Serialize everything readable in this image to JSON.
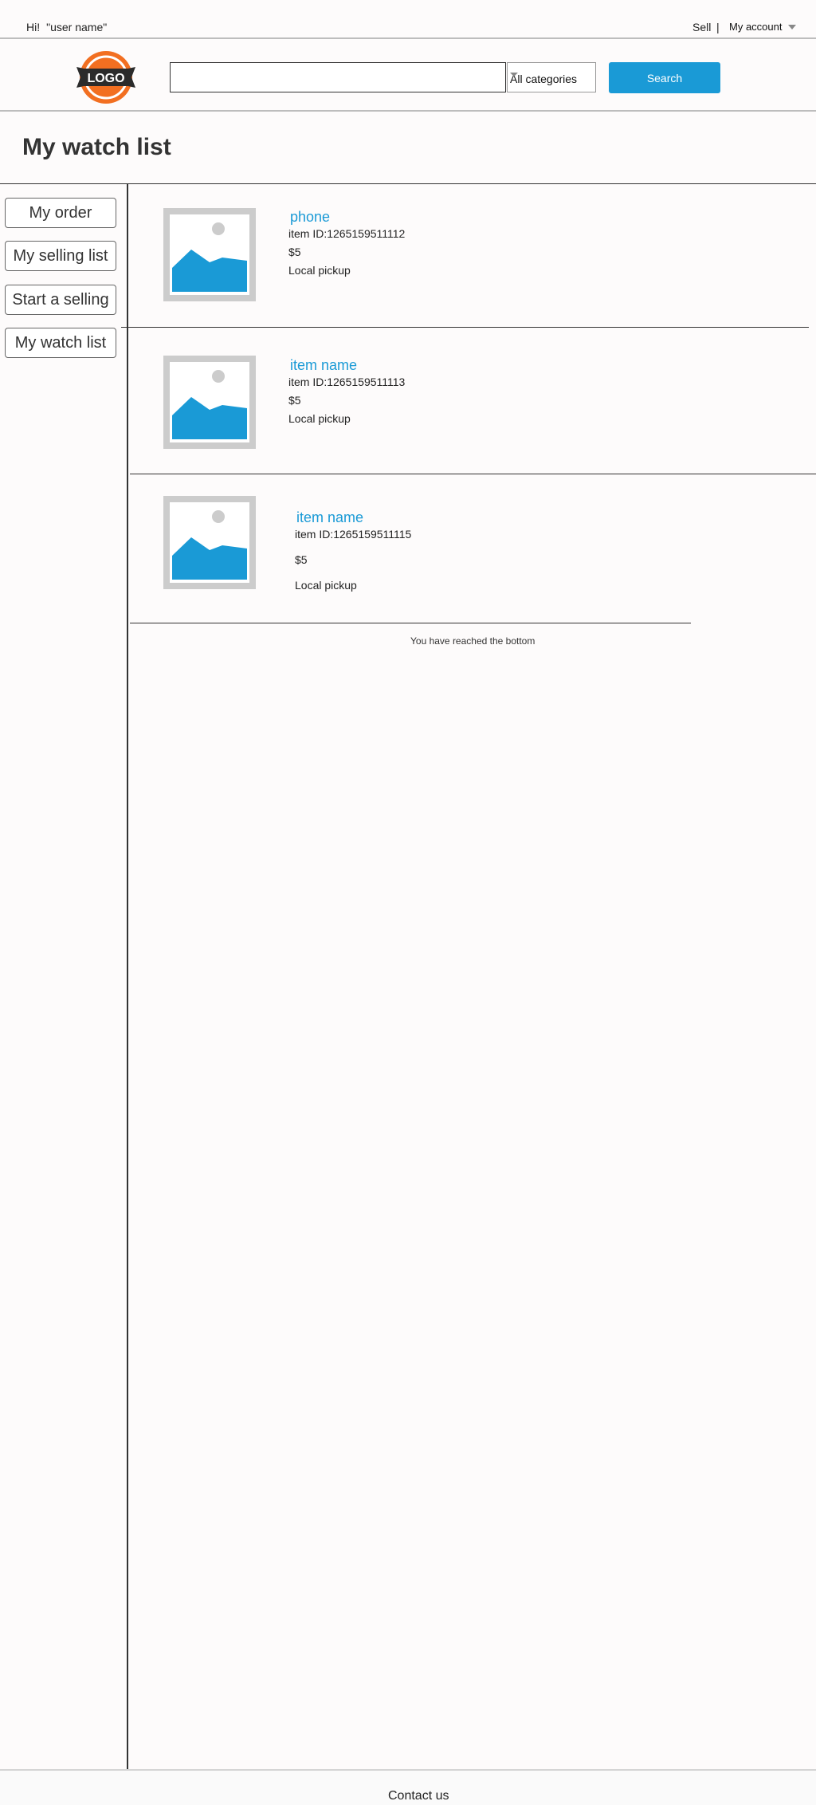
{
  "header": {
    "greeting": "Hi!",
    "user_name": "\"user name\"",
    "sell_label": "Sell",
    "separator": "|",
    "account_label": "My account"
  },
  "logo": {
    "text": "LOGO",
    "colors": {
      "ring": "#f26f21",
      "banner": "#2b2b2b"
    }
  },
  "search": {
    "input_value": "",
    "category": "All categories",
    "button_label": "Search",
    "button_color": "#1a9ad6"
  },
  "page": {
    "title": "My watch list"
  },
  "sidebar": {
    "items": [
      {
        "label": "My order"
      },
      {
        "label": "My selling list"
      },
      {
        "label": "Start a selling"
      },
      {
        "label": "My watch list"
      }
    ]
  },
  "watchlist": {
    "items": [
      {
        "name": "phone",
        "item_id": "item ID:1265159511112",
        "price": "$5",
        "shipping": "Local pickup"
      },
      {
        "name": "item name",
        "item_id": "item ID:1265159511113",
        "price": "$5",
        "shipping": "Local pickup"
      },
      {
        "name": "item name",
        "item_id": "item ID:1265159511115",
        "price": "$5",
        "shipping": "Local pickup"
      }
    ],
    "bottom_message": "You have reached the bottom"
  },
  "footer": {
    "contact_label": "Contact us"
  }
}
